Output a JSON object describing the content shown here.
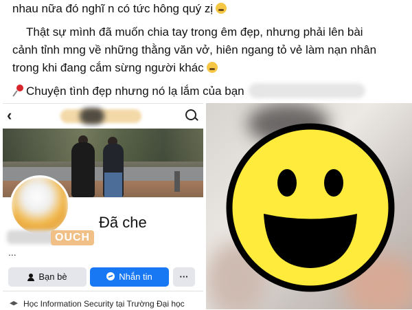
{
  "post": {
    "line1": "nhau nữa đó nghĩ n có tức hông quý zị",
    "line2": "Thật sự mình đã muốn chia tay trong êm đẹp, nhưng phải lên bài",
    "line3": "cảnh tỉnh mng về những thằng văn vở, hiên ngang tỏ vẻ làm nạn nhân",
    "line4": "trong khi đang cắm sừng người khác",
    "line5": "Chuyện tình đẹp nhưng nó lạ lắm của bạn"
  },
  "profile": {
    "back_icon": "‹",
    "display_name": "Đã che",
    "nickname": "OUCH",
    "more_dots": "...",
    "friends_label": "Bạn bè",
    "message_label": "Nhắn tin",
    "more_label": "···",
    "education": "Học Information Security tại Trường Đại học"
  },
  "colors": {
    "messenger_blue": "#1877f2",
    "smiley_yellow": "#ffeb3b"
  }
}
